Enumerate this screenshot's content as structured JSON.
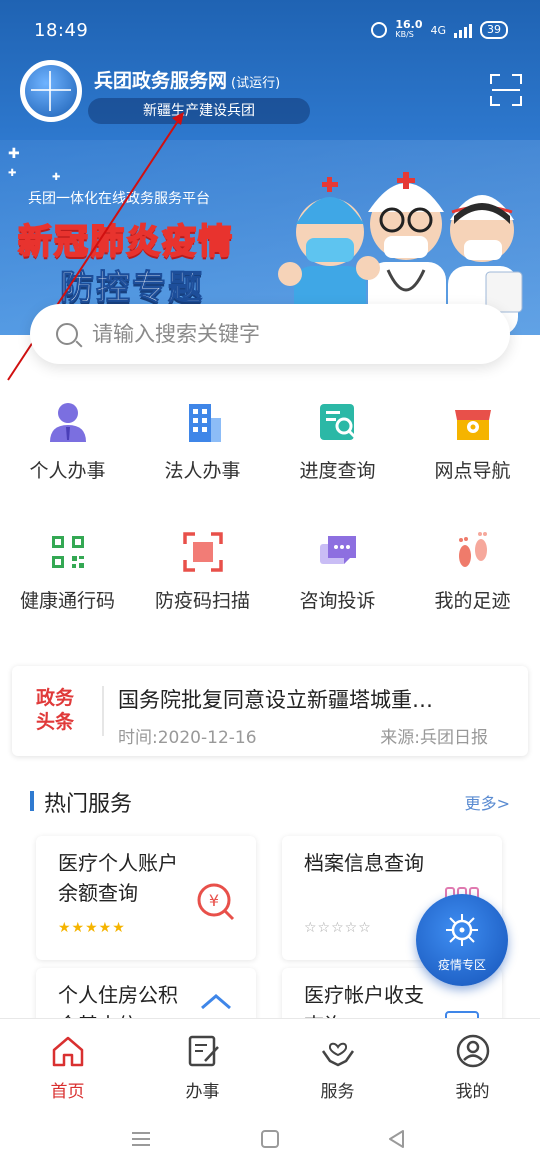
{
  "status": {
    "time": "18:49",
    "speed_value": "16.0",
    "speed_unit": "KB/S",
    "network": "4G",
    "battery": "39"
  },
  "header": {
    "title": "兵团政务服务网",
    "title_note": "(试运行)",
    "subtitle": "新疆生产建设兵团",
    "scan_icon": "scan-icon"
  },
  "banner": {
    "platform": "兵团一体化在线政务服务平台",
    "title_line1": "新冠肺炎疫情",
    "title_line2": "防控专题"
  },
  "search": {
    "placeholder": "请输入搜索关键字"
  },
  "services": [
    {
      "label": "个人办事",
      "icon": "person-icon",
      "color": "#7b6fe0"
    },
    {
      "label": "法人办事",
      "icon": "building-icon",
      "color": "#3f86e8"
    },
    {
      "label": "进度查询",
      "icon": "progress-search-icon",
      "color": "#2bb8a6"
    },
    {
      "label": "网点导航",
      "icon": "store-location-icon",
      "color": "#f5b400"
    },
    {
      "label": "健康通行码",
      "icon": "qr-code-icon",
      "color": "#34a853"
    },
    {
      "label": "防疫码扫描",
      "icon": "scan-frame-icon",
      "color": "#e8504a"
    },
    {
      "label": "咨询投诉",
      "icon": "chat-icon",
      "color": "#8d6fe0"
    },
    {
      "label": "我的足迹",
      "icon": "footprint-icon",
      "color": "#ef7b6b"
    }
  ],
  "news": {
    "tag_line1": "政务",
    "tag_line2": "头条",
    "headline": "国务院批复同意设立新疆塔城重…",
    "time": "时间:2020-12-16",
    "source": "来源:兵团日报"
  },
  "hot": {
    "title": "热门服务",
    "more": "更多>",
    "cards": [
      {
        "title": "医疗个人账户余额查询",
        "stars": "★★★★★",
        "rating": 5,
        "icon": "yuan-search-icon"
      },
      {
        "title": "档案信息查询",
        "stars": "☆☆☆☆☆",
        "rating": 0,
        "icon": "archive-icon"
      },
      {
        "title": "个人住房公积金基本信",
        "stars": "",
        "icon": "house-icon"
      },
      {
        "title": "医疗帐户收支查询",
        "stars": "",
        "icon": "account-icon"
      }
    ]
  },
  "fab": {
    "label": "疫情专区",
    "icon": "virus-icon"
  },
  "tabbar": [
    {
      "label": "首页",
      "icon": "home-icon",
      "active": true
    },
    {
      "label": "办事",
      "icon": "edit-doc-icon",
      "active": false
    },
    {
      "label": "服务",
      "icon": "hands-heart-icon",
      "active": false
    },
    {
      "label": "我的",
      "icon": "profile-icon",
      "active": false
    }
  ],
  "colors": {
    "primary": "#2f7ad0",
    "accent_red": "#d93030",
    "star_gold": "#f5b400"
  }
}
